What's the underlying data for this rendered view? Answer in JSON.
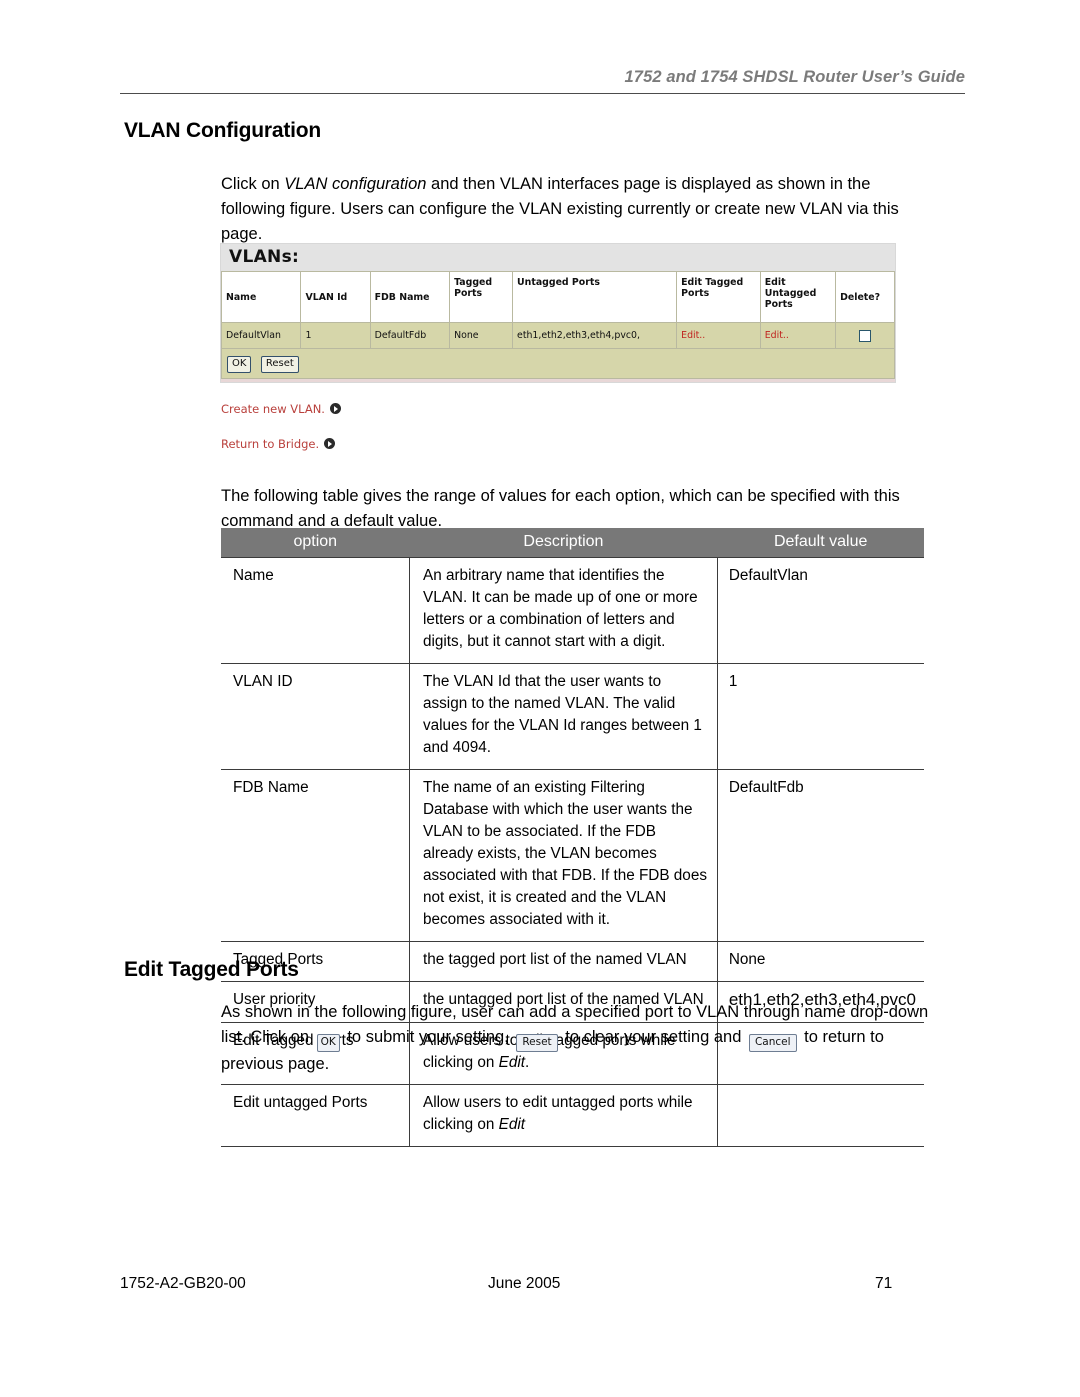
{
  "page": {
    "running_header": "1752 and 1754 SHDSL Router User’s Guide",
    "footer": {
      "doc_number": "1752-A2-GB20-00",
      "date": "June 2005",
      "page_number": "71"
    }
  },
  "sections": {
    "vlan_configuration": {
      "heading": "VLAN Configuration",
      "intro_before_italic": "Click on ",
      "intro_italic": "VLAN configuration",
      "intro_after_italic": " and then VLAN interfaces page is displayed as shown in the following figure. Users can configure the VLAN existing currently or create new VLAN via this page.",
      "table_intro": "The following table gives the range of values for each option, which can be specified with this command and a default value."
    },
    "edit_tagged_ports": {
      "heading": "Edit Tagged Ports",
      "par_part1": "As shown in the following figure, user can add a specified port to VLAN through name drop-down list. Click on ",
      "btn_ok": "OK",
      "par_part2": " to submit your setting, ",
      "btn_reset": "Reset",
      "par_part3": " to clear your setting and ",
      "btn_cancel": "Cancel",
      "par_part4": " to return to previous page."
    }
  },
  "vlan_screenshot": {
    "title": "VLANs:",
    "headers": [
      "Name",
      "VLAN Id",
      "FDB Name",
      "Tagged Ports",
      "Untagged Ports",
      "Edit Tagged Ports",
      "Edit Untagged Ports",
      "Delete?"
    ],
    "rows": [
      {
        "name": "DefaultVlan",
        "vlan_id": "1",
        "fdb_name": "DefaultFdb",
        "tagged_ports": "None",
        "untagged_ports": "eth1,eth2,eth3,eth4,pvc0,",
        "edit_tagged": "Edit..",
        "edit_untagged": "Edit..",
        "delete_checked": false
      }
    ],
    "buttons": {
      "ok": "OK",
      "reset": "Reset"
    },
    "links": [
      "Create new VLAN.",
      "Return to Bridge."
    ],
    "colors": {
      "row_background": "#d6d6aa",
      "title_background": "#e3e3e3",
      "link_text": "#b9403c",
      "edit_link": "#c0241f"
    }
  },
  "options_table": {
    "columns": [
      "option",
      "Description",
      "Default value"
    ],
    "header_background": "#787878",
    "rows": [
      {
        "option": "Name",
        "description": "An arbitrary name that identifies the VLAN. It can be made up of one or more letters or a combination of letters and digits, but it cannot start with a digit.",
        "default": "DefaultVlan"
      },
      {
        "option": "VLAN ID",
        "description": "The VLAN Id that the user wants to assign to the named VLAN. The valid values for the VLAN Id ranges between 1 and 4094.",
        "default": "1"
      },
      {
        "option": "FDB Name",
        "description": "The name of an existing Filtering Database with which the user wants the VLAN to be associated. If the FDB already exists, the VLAN becomes associated with that FDB. If the FDB does not exist, it is created and the VLAN becomes associated with it.",
        "default": "DefaultFdb"
      },
      {
        "option": "Tagged Ports",
        "description": "the tagged port list of the named VLAN",
        "default": "None"
      },
      {
        "option": "User priority",
        "description": "the untagged port list of the named VLAN",
        "default": "eth1,eth2,eth3,eth4,pvc0"
      },
      {
        "option": "Edit Tagged Ports",
        "description_before_italic": "Allow users to edit tagged ports while clicking on ",
        "description_italic": "Edit",
        "description_after_italic": ".",
        "default": ""
      },
      {
        "option": "Edit untagged Ports",
        "description_before_italic": "Allow users to edit untagged ports while clicking on ",
        "description_italic": "Edit",
        "description_after_italic": "",
        "default": ""
      }
    ]
  }
}
